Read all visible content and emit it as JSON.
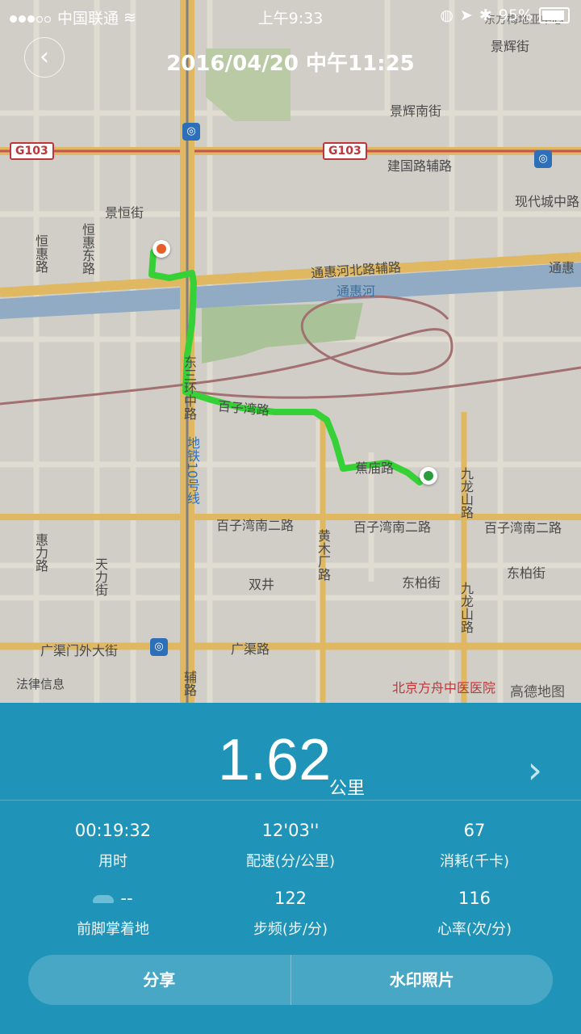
{
  "status_bar": {
    "carrier": "中国联通",
    "time": "上午9:33",
    "battery": "95%"
  },
  "header": {
    "title": "2016/04/20 中午11:25"
  },
  "map": {
    "labels": {
      "jinghui_nan": "景辉南街",
      "jinghui": "景辉街",
      "jingheng": "景恒街",
      "jianguolu_fudao": "建国路辅路",
      "xiandai_zhong": "现代城中路",
      "tonghuihe_bei": "通惠河北路辅路",
      "tonghui_right": "通惠",
      "tonghuihe": "通惠河",
      "hengtong": "恒惠路",
      "hengtong_dong": "恒惠东路",
      "baiziwan": "百子湾路",
      "jiadan": "蕉庙路",
      "baiziwan_nan_1": "百子湾南二路",
      "baiziwan_nan_2": "百子湾南二路",
      "baiziwan_nan_3": "百子湾南二路",
      "dongbai_1": "东柏街",
      "dongbai_2": "东柏街",
      "shuangjing": "双井",
      "huangmuchang": "黄木厂路",
      "jiulong_1": "九龙山路",
      "jiulong_2": "九龙山路",
      "guangqumen": "广渠门外大街",
      "guangqu": "广渠路",
      "tianli": "天力街",
      "huili": "惠力路",
      "dongsan": "东三环中路",
      "subway10": "地铁10号线",
      "fuzhu": "辅路",
      "fangzhou": "北京方舟中医医院",
      "dongfang_top": "东方梅地亚中心",
      "legal": "法律信息",
      "gaode": "高德地图",
      "g103_left": "G103",
      "g103_mid": "G103"
    }
  },
  "summary": {
    "distance": "1.62",
    "distance_unit": "公里"
  },
  "stats": [
    {
      "value": "00:19:32",
      "label": "用时"
    },
    {
      "value": "12'03''",
      "label": "配速(分/公里)"
    },
    {
      "value": "67",
      "label": "消耗(千卡)"
    },
    {
      "value": "--",
      "label": "前脚掌着地"
    },
    {
      "value": "122",
      "label": "步频(步/分)"
    },
    {
      "value": "116",
      "label": "心率(次/分)"
    }
  ],
  "actions": {
    "share": "分享",
    "watermark": "水印照片"
  },
  "colors": {
    "route": "#3be33b",
    "panel": "#1f94b8",
    "start_pin": "#e85d2a",
    "end_pin": "#2a9d3a"
  }
}
